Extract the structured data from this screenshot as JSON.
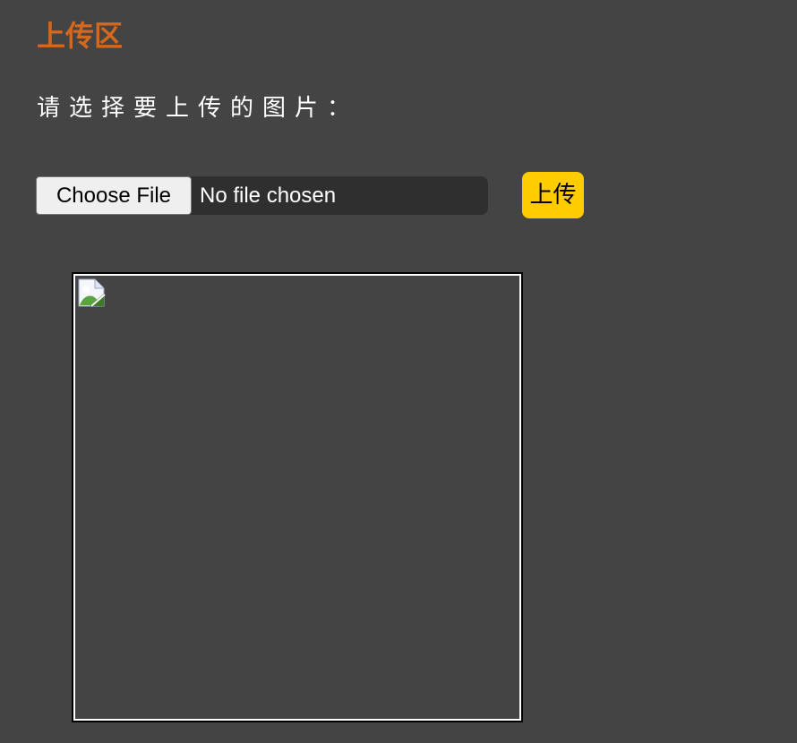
{
  "header": {
    "title": "上传区"
  },
  "form": {
    "prompt": "请选择要上传的图片：",
    "choose_file_label": "Choose File",
    "no_file_text": "No file chosen",
    "upload_label": "上传"
  },
  "preview": {
    "image_icon": "broken-image-icon"
  },
  "colors": {
    "background": "#444444",
    "title": "#d2691e",
    "upload_button": "#ffcc00"
  }
}
